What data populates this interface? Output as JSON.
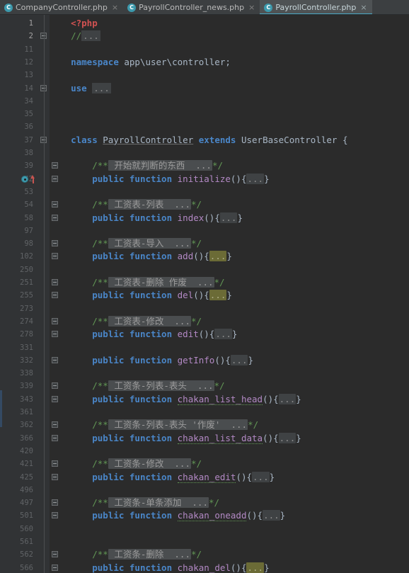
{
  "window": {
    "theme": "darcula",
    "background": "#2b2b2b",
    "accent": "#4aa8c4"
  },
  "tabs": [
    {
      "label": "CompanyController.php",
      "icon": "php-class-icon",
      "close": "×",
      "active": false,
      "icon_letter": "C"
    },
    {
      "label": "PayrollController_news.php",
      "icon": "php-class-icon",
      "close": "×",
      "active": false,
      "icon_letter": "C"
    },
    {
      "label": "PayrollController.php",
      "icon": "php-class-icon",
      "close": "×",
      "active": true,
      "icon_letter": "C"
    }
  ],
  "editor": {
    "language": "PHP",
    "file": "PayrollController.php",
    "lines": [
      {
        "num": "1",
        "fold": false,
        "indent": 0,
        "gicon": false,
        "current": true,
        "tokens": [
          {
            "t": "    ",
            "c": "plain"
          },
          {
            "t": "<?php",
            "c": "tag"
          }
        ]
      },
      {
        "num": "2",
        "fold": true,
        "indent": 0,
        "gicon": false,
        "current": true,
        "tokens": [
          {
            "t": "    ",
            "c": "plain"
          },
          {
            "t": "//",
            "c": "cmt"
          },
          {
            "t": "...",
            "c": "fdots"
          }
        ]
      },
      {
        "num": "11",
        "fold": false,
        "indent": 0,
        "gicon": false,
        "current": false,
        "tokens": []
      },
      {
        "num": "12",
        "fold": false,
        "indent": 0,
        "gicon": false,
        "current": false,
        "tokens": [
          {
            "t": "    ",
            "c": "plain"
          },
          {
            "t": "namespace",
            "c": "kw"
          },
          {
            "t": " app\\user\\controller;",
            "c": "plain"
          }
        ]
      },
      {
        "num": "13",
        "fold": false,
        "indent": 0,
        "gicon": false,
        "current": false,
        "tokens": []
      },
      {
        "num": "14",
        "fold": true,
        "indent": 0,
        "gicon": false,
        "current": false,
        "tokens": [
          {
            "t": "    ",
            "c": "plain"
          },
          {
            "t": "use",
            "c": "kw"
          },
          {
            "t": " ",
            "c": "plain"
          },
          {
            "t": "...",
            "c": "fdots"
          }
        ]
      },
      {
        "num": "34",
        "fold": false,
        "indent": 0,
        "gicon": false,
        "current": false,
        "tokens": []
      },
      {
        "num": "35",
        "fold": false,
        "indent": 0,
        "gicon": false,
        "current": false,
        "tokens": []
      },
      {
        "num": "36",
        "fold": false,
        "indent": 0,
        "gicon": false,
        "current": false,
        "tokens": []
      },
      {
        "num": "37",
        "fold": true,
        "indent": 0,
        "gicon": false,
        "current": false,
        "tokens": [
          {
            "t": "    ",
            "c": "plain"
          },
          {
            "t": "class",
            "c": "kw"
          },
          {
            "t": " ",
            "c": "plain"
          },
          {
            "t": "PayrollController",
            "c": "cls"
          },
          {
            "t": " ",
            "c": "plain"
          },
          {
            "t": "extends",
            "c": "kw"
          },
          {
            "t": " UserBaseController {",
            "c": "plain"
          }
        ]
      },
      {
        "num": "38",
        "fold": false,
        "indent": 0,
        "gicon": false,
        "current": false,
        "tokens": []
      },
      {
        "num": "39",
        "fold": true,
        "indent": 1,
        "gicon": false,
        "current": false,
        "tokens": [
          {
            "t": "        ",
            "c": "plain"
          },
          {
            "t": "/**",
            "c": "cmt"
          },
          {
            "t": " 开始就判断的东西  ...",
            "c": "fcmt"
          },
          {
            "t": "*/",
            "c": "cmt"
          }
        ]
      },
      {
        "num": "42",
        "fold": true,
        "indent": 1,
        "gicon": true,
        "current": false,
        "tokens": [
          {
            "t": "        ",
            "c": "plain"
          },
          {
            "t": "public function",
            "c": "kw"
          },
          {
            "t": " ",
            "c": "plain"
          },
          {
            "t": "initialize",
            "c": "fn"
          },
          {
            "t": "(){",
            "c": "plain"
          },
          {
            "t": "...",
            "c": "fchip"
          },
          {
            "t": "}",
            "c": "plain"
          }
        ]
      },
      {
        "num": "53",
        "fold": false,
        "indent": 0,
        "gicon": false,
        "current": false,
        "tokens": []
      },
      {
        "num": "54",
        "fold": true,
        "indent": 1,
        "gicon": false,
        "current": false,
        "tokens": [
          {
            "t": "        ",
            "c": "plain"
          },
          {
            "t": "/**",
            "c": "cmt"
          },
          {
            "t": " 工资表-列表  ...",
            "c": "fcmt"
          },
          {
            "t": "*/",
            "c": "cmt"
          }
        ]
      },
      {
        "num": "58",
        "fold": true,
        "indent": 1,
        "gicon": false,
        "current": false,
        "tokens": [
          {
            "t": "        ",
            "c": "plain"
          },
          {
            "t": "public function",
            "c": "kw"
          },
          {
            "t": " ",
            "c": "plain"
          },
          {
            "t": "index",
            "c": "fn"
          },
          {
            "t": "(){",
            "c": "plain"
          },
          {
            "t": "...",
            "c": "fchip"
          },
          {
            "t": "}",
            "c": "plain"
          }
        ]
      },
      {
        "num": "97",
        "fold": false,
        "indent": 0,
        "gicon": false,
        "current": false,
        "tokens": []
      },
      {
        "num": "98",
        "fold": true,
        "indent": 1,
        "gicon": false,
        "current": false,
        "tokens": [
          {
            "t": "        ",
            "c": "plain"
          },
          {
            "t": "/**",
            "c": "cmt"
          },
          {
            "t": " 工资表-导入  ...",
            "c": "fcmt"
          },
          {
            "t": "*/",
            "c": "cmt"
          }
        ]
      },
      {
        "num": "102",
        "fold": true,
        "indent": 1,
        "gicon": false,
        "current": false,
        "tokens": [
          {
            "t": "        ",
            "c": "plain"
          },
          {
            "t": "public function",
            "c": "kw"
          },
          {
            "t": " ",
            "c": "plain"
          },
          {
            "t": "add",
            "c": "fn"
          },
          {
            "t": "(){",
            "c": "plain"
          },
          {
            "t": "...",
            "c": "fchip hl"
          },
          {
            "t": "}",
            "c": "plain"
          }
        ]
      },
      {
        "num": "250",
        "fold": false,
        "indent": 0,
        "gicon": false,
        "current": false,
        "tokens": []
      },
      {
        "num": "251",
        "fold": true,
        "indent": 1,
        "gicon": false,
        "current": false,
        "tokens": [
          {
            "t": "        ",
            "c": "plain"
          },
          {
            "t": "/**",
            "c": "cmt"
          },
          {
            "t": " 工资表-删除 作废  ...",
            "c": "fcmt"
          },
          {
            "t": "*/",
            "c": "cmt"
          }
        ]
      },
      {
        "num": "255",
        "fold": true,
        "indent": 1,
        "gicon": false,
        "current": false,
        "tokens": [
          {
            "t": "        ",
            "c": "plain"
          },
          {
            "t": "public function",
            "c": "kw"
          },
          {
            "t": " ",
            "c": "plain"
          },
          {
            "t": "del",
            "c": "fn"
          },
          {
            "t": "(){",
            "c": "plain"
          },
          {
            "t": "...",
            "c": "fchip hl"
          },
          {
            "t": "}",
            "c": "plain"
          }
        ]
      },
      {
        "num": "273",
        "fold": false,
        "indent": 0,
        "gicon": false,
        "current": false,
        "tokens": []
      },
      {
        "num": "274",
        "fold": true,
        "indent": 1,
        "gicon": false,
        "current": false,
        "tokens": [
          {
            "t": "        ",
            "c": "plain"
          },
          {
            "t": "/**",
            "c": "cmt"
          },
          {
            "t": " 工资表-修改  ...",
            "c": "fcmt"
          },
          {
            "t": "*/",
            "c": "cmt"
          }
        ]
      },
      {
        "num": "278",
        "fold": true,
        "indent": 1,
        "gicon": false,
        "current": false,
        "tokens": [
          {
            "t": "        ",
            "c": "plain"
          },
          {
            "t": "public function",
            "c": "kw"
          },
          {
            "t": " ",
            "c": "plain"
          },
          {
            "t": "edit",
            "c": "fn"
          },
          {
            "t": "(){",
            "c": "plain"
          },
          {
            "t": "...",
            "c": "fchip"
          },
          {
            "t": "}",
            "c": "plain"
          }
        ]
      },
      {
        "num": "331",
        "fold": false,
        "indent": 0,
        "gicon": false,
        "current": false,
        "tokens": []
      },
      {
        "num": "332",
        "fold": true,
        "indent": 1,
        "gicon": false,
        "current": false,
        "tokens": [
          {
            "t": "        ",
            "c": "plain"
          },
          {
            "t": "public function",
            "c": "kw"
          },
          {
            "t": " ",
            "c": "plain"
          },
          {
            "t": "getInfo",
            "c": "fn"
          },
          {
            "t": "(){",
            "c": "plain"
          },
          {
            "t": "...",
            "c": "fchip"
          },
          {
            "t": "}",
            "c": "plain"
          }
        ]
      },
      {
        "num": "338",
        "fold": false,
        "indent": 0,
        "gicon": false,
        "current": false,
        "tokens": []
      },
      {
        "num": "339",
        "fold": true,
        "indent": 1,
        "gicon": false,
        "current": false,
        "tokens": [
          {
            "t": "        ",
            "c": "plain"
          },
          {
            "t": "/**",
            "c": "cmt"
          },
          {
            "t": " 工资条-列表-表头  ...",
            "c": "fcmt"
          },
          {
            "t": "*/",
            "c": "cmt"
          }
        ]
      },
      {
        "num": "343",
        "fold": true,
        "indent": 1,
        "gicon": false,
        "current": false,
        "tokens": [
          {
            "t": "        ",
            "c": "plain"
          },
          {
            "t": "public function",
            "c": "kw"
          },
          {
            "t": " ",
            "c": "plain"
          },
          {
            "t": "chakan_list_head",
            "c": "fnu"
          },
          {
            "t": "(){",
            "c": "plain"
          },
          {
            "t": "...",
            "c": "fchip"
          },
          {
            "t": "}",
            "c": "plain"
          }
        ]
      },
      {
        "num": "361",
        "fold": false,
        "indent": 0,
        "gicon": false,
        "current": false,
        "tokens": []
      },
      {
        "num": "362",
        "fold": true,
        "indent": 1,
        "gicon": false,
        "current": false,
        "tokens": [
          {
            "t": "        ",
            "c": "plain"
          },
          {
            "t": "/**",
            "c": "cmt"
          },
          {
            "t": " 工资条-列表-表头 '作废'  ...",
            "c": "fcmt"
          },
          {
            "t": "*/",
            "c": "cmt"
          }
        ]
      },
      {
        "num": "366",
        "fold": true,
        "indent": 1,
        "gicon": false,
        "current": false,
        "tokens": [
          {
            "t": "        ",
            "c": "plain"
          },
          {
            "t": "public function",
            "c": "kw"
          },
          {
            "t": " ",
            "c": "plain"
          },
          {
            "t": "chakan_list_data",
            "c": "fnu"
          },
          {
            "t": "(){",
            "c": "plain"
          },
          {
            "t": "...",
            "c": "fchip"
          },
          {
            "t": "}",
            "c": "plain"
          }
        ]
      },
      {
        "num": "420",
        "fold": false,
        "indent": 0,
        "gicon": false,
        "current": false,
        "tokens": []
      },
      {
        "num": "421",
        "fold": true,
        "indent": 1,
        "gicon": false,
        "current": false,
        "tokens": [
          {
            "t": "        ",
            "c": "plain"
          },
          {
            "t": "/**",
            "c": "cmt"
          },
          {
            "t": " 工资条-修改  ...",
            "c": "fcmt"
          },
          {
            "t": "*/",
            "c": "cmt"
          }
        ]
      },
      {
        "num": "425",
        "fold": true,
        "indent": 1,
        "gicon": false,
        "current": false,
        "tokens": [
          {
            "t": "        ",
            "c": "plain"
          },
          {
            "t": "public function",
            "c": "kw"
          },
          {
            "t": " ",
            "c": "plain"
          },
          {
            "t": "chakan_edit",
            "c": "fnu"
          },
          {
            "t": "(){",
            "c": "plain"
          },
          {
            "t": "...",
            "c": "fchip"
          },
          {
            "t": "}",
            "c": "plain"
          }
        ]
      },
      {
        "num": "496",
        "fold": false,
        "indent": 0,
        "gicon": false,
        "current": false,
        "tokens": []
      },
      {
        "num": "497",
        "fold": true,
        "indent": 1,
        "gicon": false,
        "current": false,
        "tokens": [
          {
            "t": "        ",
            "c": "plain"
          },
          {
            "t": "/**",
            "c": "cmt"
          },
          {
            "t": " 工资条-单条添加  ...",
            "c": "fcmt"
          },
          {
            "t": "*/",
            "c": "cmt"
          }
        ]
      },
      {
        "num": "501",
        "fold": true,
        "indent": 1,
        "gicon": false,
        "current": false,
        "tokens": [
          {
            "t": "        ",
            "c": "plain"
          },
          {
            "t": "public function",
            "c": "kw"
          },
          {
            "t": " ",
            "c": "plain"
          },
          {
            "t": "chakan_oneadd",
            "c": "fnu"
          },
          {
            "t": "(){",
            "c": "plain"
          },
          {
            "t": "...",
            "c": "fchip"
          },
          {
            "t": "}",
            "c": "plain"
          }
        ]
      },
      {
        "num": "560",
        "fold": false,
        "indent": 0,
        "gicon": false,
        "current": false,
        "tokens": []
      },
      {
        "num": "561",
        "fold": false,
        "indent": 0,
        "gicon": false,
        "current": false,
        "tokens": []
      },
      {
        "num": "562",
        "fold": true,
        "indent": 1,
        "gicon": false,
        "current": false,
        "tokens": [
          {
            "t": "        ",
            "c": "plain"
          },
          {
            "t": "/**",
            "c": "cmt"
          },
          {
            "t": " 工资条-删除  ...",
            "c": "fcmt"
          },
          {
            "t": "*/",
            "c": "cmt"
          }
        ]
      },
      {
        "num": "566",
        "fold": true,
        "indent": 1,
        "gicon": false,
        "current": false,
        "tokens": [
          {
            "t": "        ",
            "c": "plain"
          },
          {
            "t": "public function",
            "c": "kw"
          },
          {
            "t": " ",
            "c": "plain"
          },
          {
            "t": "chakan_del",
            "c": "fnu"
          },
          {
            "t": "(){",
            "c": "plain"
          },
          {
            "t": "...",
            "c": "fchip hl"
          },
          {
            "t": "}",
            "c": "plain"
          }
        ]
      }
    ]
  }
}
